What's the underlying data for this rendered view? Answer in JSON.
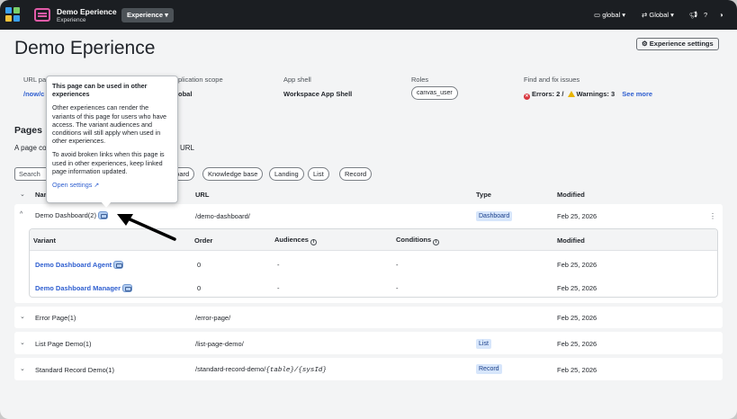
{
  "topbar": {
    "app_title": "Demo Eperience",
    "app_subtitle": "Experience",
    "experience_menu": "Experience ▾",
    "scope_selector": "global",
    "language_selector": "Global",
    "icons": [
      "grid-logo-icon",
      "app-window-icon",
      "monitor-icon",
      "translate-icon",
      "megaphone-icon",
      "help-icon",
      "contrast-icon"
    ]
  },
  "page": {
    "title": "Demo Eperience",
    "settings_button": "⚙ Experience settings"
  },
  "meta": {
    "url_label": "URL pa",
    "url_value": "/now/c",
    "scope_label": "plication scope",
    "scope_value": "obal",
    "shell_label": "App shell",
    "shell_value": "Workspace App Shell",
    "roles_label": "Roles",
    "role_pill": "canvas_user",
    "issues_label": "Find and fix issues",
    "errors_text": "Errors: 2 /",
    "warnings_text": "Warnings: 3",
    "see_more": "See more"
  },
  "pages_section": {
    "heading": "Pages",
    "desc_left": "A page co",
    "desc_right": "URL",
    "search_placeholder": "Search",
    "filters": [
      "board",
      "Knowledge base",
      "Landing",
      "List",
      "Record"
    ],
    "col_name": "Nar",
    "col_url": "URL",
    "col_type": "Type",
    "col_modified": "Modified",
    "rows": [
      {
        "name": "Demo Dashboard(2)",
        "url": "/demo-dashboard/",
        "type": "Dashboard",
        "modified": "Feb 25, 2026"
      },
      {
        "name": "Error Page(1)",
        "url": "/error-page/",
        "type": "",
        "modified": "Feb 25, 2026"
      },
      {
        "name": "List Page Demo(1)",
        "url": "/list-page-demo/",
        "type": "List",
        "modified": "Feb 25, 2026"
      },
      {
        "name": "Standard Record Demo(1)",
        "url_prefix": "/standard-record-demo/",
        "url_params": "{table}/{sysId}",
        "type": "Record",
        "modified": "Feb 25, 2026"
      }
    ]
  },
  "variants": {
    "col_variant": "Variant",
    "col_order": "Order",
    "col_audiences": "Audiences",
    "col_conditions": "Conditions",
    "col_modified": "Modified",
    "rows": [
      {
        "name": "Demo Dashboard Agent",
        "order": "0",
        "audiences": "-",
        "conditions": "-",
        "modified": "Feb 25, 2026"
      },
      {
        "name": "Demo Dashboard Manager",
        "order": "0",
        "audiences": "-",
        "conditions": "-",
        "modified": "Feb 25, 2026"
      }
    ]
  },
  "tooltip": {
    "title": "This page can be used in other experiences",
    "para1": "Other experiences can render the variants of this page for users who have access. The variant audiences and conditions will still apply when used in other experiences.",
    "para2": "To avoid broken links when this page is used in other experiences, keep linked page information updated.",
    "link": "Open settings ↗"
  }
}
